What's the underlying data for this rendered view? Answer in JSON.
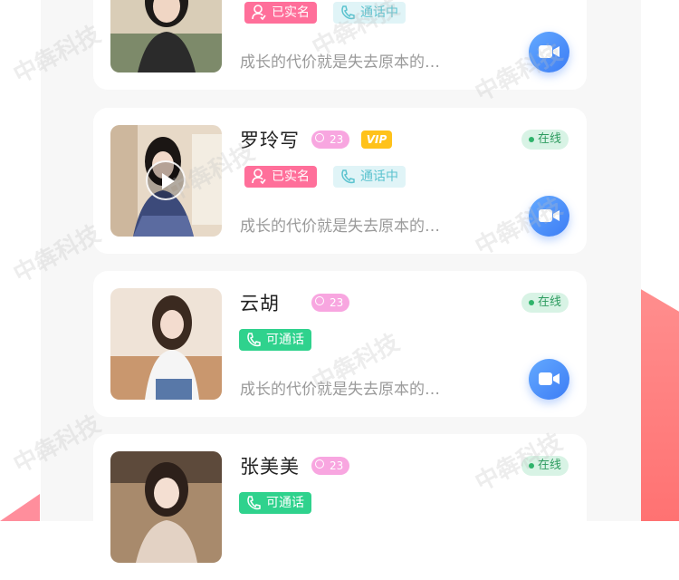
{
  "intro_text": "成长的代价就是失去原本的…",
  "cards": [
    {
      "name": "",
      "age": "",
      "online_label": "",
      "tags": [
        "已实名",
        "通话中"
      ],
      "has_video": false
    },
    {
      "name": "罗玲写",
      "age": "23",
      "vip": "VIP",
      "online_label": "在线",
      "tags": [
        "已实名",
        "通话中"
      ],
      "has_video": true
    },
    {
      "name": "云胡",
      "age": "23",
      "online_label": "在线",
      "tags": [
        "可通话"
      ],
      "has_video": false
    },
    {
      "name": "张美美",
      "age": "23",
      "online_label": "在线",
      "tags": [
        "可通话"
      ],
      "has_video": false
    }
  ],
  "watermark_text": "中犇科技",
  "colors": {
    "verified": "#ff6f9a",
    "calling_bg": "#e0f4f7",
    "calling_text": "#5cc3cf",
    "available": "#2fd28d",
    "online_bg": "#d8f3e5",
    "online_text": "#2d9b5f",
    "video_button": "#4a8cf7",
    "age_badge": "#f8a6e0",
    "vip": "#ffc21a"
  },
  "icons": {
    "video": "video-camera-icon",
    "verified": "user-check-icon",
    "phone": "phone-icon",
    "play": "play-icon"
  }
}
